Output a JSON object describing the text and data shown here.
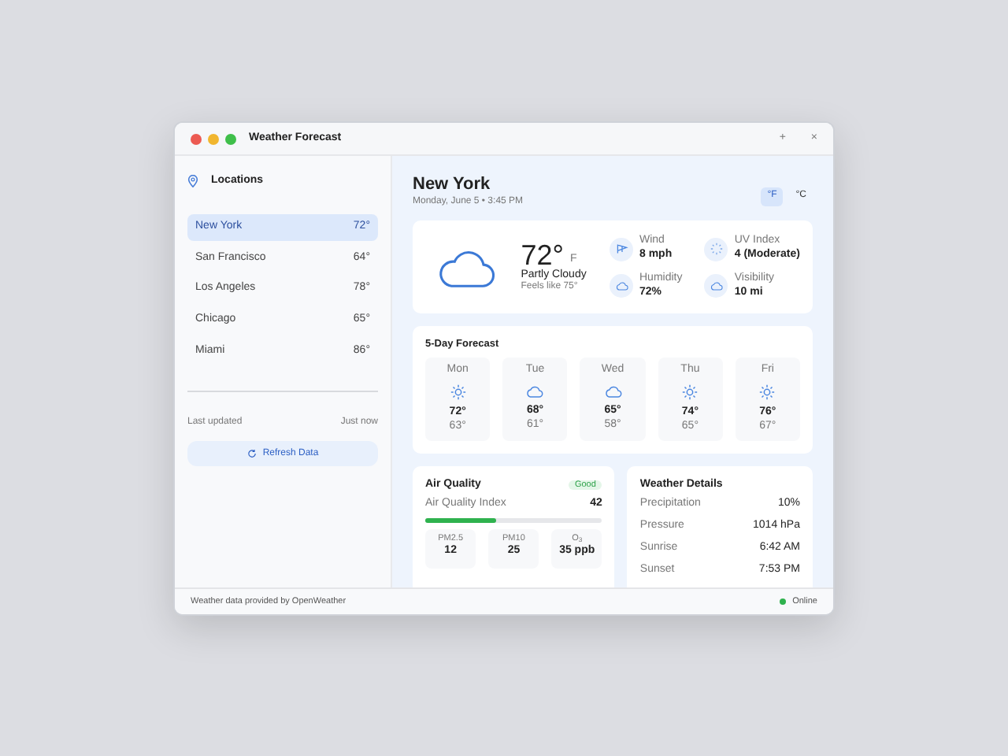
{
  "window": {
    "title": "Weather Forecast",
    "actions": [
      "+",
      "×"
    ]
  },
  "sidebar": {
    "title": "Locations",
    "locations": [
      {
        "name": "New York",
        "temp": "72°",
        "selected": true
      },
      {
        "name": "San Francisco",
        "temp": "64°",
        "selected": false
      },
      {
        "name": "Los Angeles",
        "temp": "78°",
        "selected": false
      },
      {
        "name": "Chicago",
        "temp": "65°",
        "selected": false
      },
      {
        "name": "Miami",
        "temp": "86°",
        "selected": false
      }
    ],
    "last_updated_label": "Last updated",
    "last_updated_value": "Just now",
    "refresh_button": "Refresh Data"
  },
  "header": {
    "city": "New York",
    "date": "Monday, June 5 • 3:45 PM",
    "units": [
      {
        "label": "°F",
        "selected": true
      },
      {
        "label": "°C",
        "selected": false
      }
    ]
  },
  "current": {
    "temp": "72°",
    "unit": "F",
    "condition": "Partly Cloudy",
    "feels_like": "Feels like 75°",
    "details": [
      {
        "kind": "wind",
        "label": "Wind",
        "value": "8 mph"
      },
      {
        "kind": "uv",
        "label": "UV Index",
        "value": "4 (Moderate)"
      },
      {
        "kind": "humidity",
        "label": "Humidity",
        "value": "72%"
      },
      {
        "kind": "visibility",
        "label": "Visibility",
        "value": "10 mi"
      }
    ]
  },
  "forecast": {
    "title": "5-Day Forecast",
    "days": [
      {
        "day": "Mon",
        "kind": "sun",
        "high": "72°",
        "low": "63°"
      },
      {
        "day": "Tue",
        "kind": "cloud",
        "high": "68°",
        "low": "61°"
      },
      {
        "day": "Wed",
        "kind": "cloud",
        "high": "65°",
        "low": "58°"
      },
      {
        "day": "Thu",
        "kind": "sun",
        "high": "74°",
        "low": "65°"
      },
      {
        "day": "Fri",
        "kind": "sun",
        "high": "76°",
        "low": "67°"
      }
    ]
  },
  "air_quality": {
    "title": "Air Quality",
    "badge": "Good",
    "index_label": "Air Quality Index",
    "index_value": "42",
    "level": 0.4,
    "pollutants": [
      {
        "name": "PM2.5",
        "value": "12"
      },
      {
        "name": "PM10",
        "value": "25"
      },
      {
        "name": "O$_{3}$",
        "value": "35 ppb"
      }
    ]
  },
  "weather_details": {
    "title": "Weather Details",
    "rows": [
      {
        "label": "Precipitation",
        "value": "10%"
      },
      {
        "label": "Pressure",
        "value": "1014 hPa"
      },
      {
        "label": "Sunrise",
        "value": "6:42 AM"
      },
      {
        "label": "Sunset",
        "value": "7:53 PM"
      }
    ]
  },
  "status_bar": {
    "text": "Weather data provided by OpenWeather",
    "status": "Online",
    "online": true
  }
}
